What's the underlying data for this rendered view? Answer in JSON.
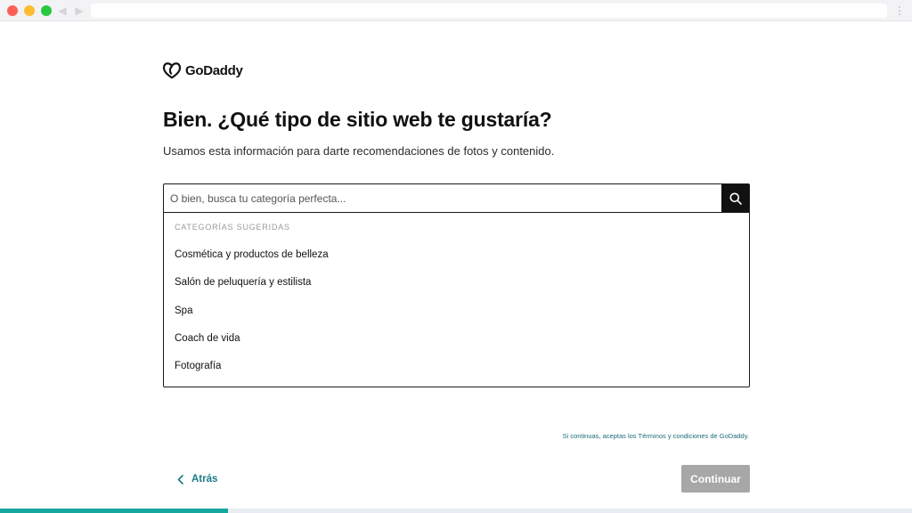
{
  "brand": {
    "name": "GoDaddy"
  },
  "page": {
    "title": "Bien. ¿Qué tipo de sitio web te gustaría?",
    "subtitle": "Usamos esta información para darte recomendaciones de fotos y contenido."
  },
  "search": {
    "placeholder": "O bien, busca tu categoría perfecta...",
    "value": "",
    "icon": "search-icon",
    "section_label": "CATEGORÍAS SUGERIDAS",
    "suggestions": [
      "Cosmética y productos de belleza",
      "Salón de peluquería y estilista",
      "Spa",
      "Coach de vida",
      "Fotografía"
    ]
  },
  "footer": {
    "terms": "Si continuas, aceptas los Términos y condiciones de GoDaddy.",
    "back_label": "Atrás",
    "continue_label": "Continuar"
  },
  "progress": {
    "fraction": 0.25
  },
  "colors": {
    "accent": "#1a7a87",
    "progress": "#14a89e",
    "disabled_button": "#a7a7a7",
    "search_button": "#111111"
  }
}
